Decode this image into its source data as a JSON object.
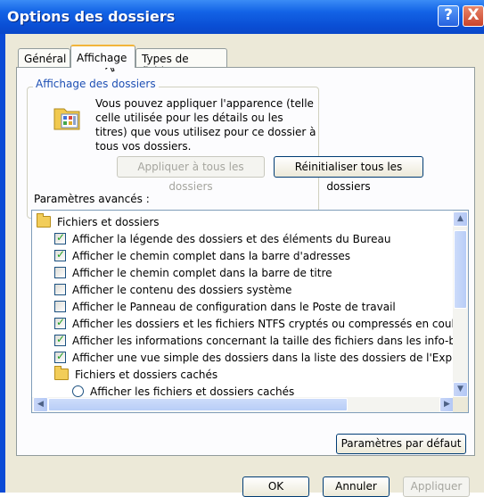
{
  "window": {
    "title": "Options des dossiers",
    "help_label": "?",
    "close_label": "X"
  },
  "tabs": [
    {
      "label": "Général"
    },
    {
      "label": "Affichage",
      "active": true
    },
    {
      "label": "Types de fichiers"
    }
  ],
  "folder_view": {
    "group_title": "Affichage des dossiers",
    "description": "Vous pouvez appliquer l'apparence (telle celle utilisée pour les détails ou les titres) que vous utilisez pour ce dossier à tous vos dossiers.",
    "apply_all_label": "Appliquer à tous les dossiers",
    "reset_all_label": "Réinitialiser tous les dossiers"
  },
  "advanced": {
    "label": "Paramètres avancés :",
    "items": [
      {
        "type": "folder",
        "text": "Fichiers et dossiers"
      },
      {
        "type": "checkbox",
        "checked": true,
        "text": "Afficher la légende des dossiers et des éléments du Bureau"
      },
      {
        "type": "checkbox",
        "checked": true,
        "text": "Afficher le chemin complet dans la barre d'adresses"
      },
      {
        "type": "checkbox",
        "checked": false,
        "text": "Afficher le chemin complet dans la barre de titre"
      },
      {
        "type": "checkbox",
        "checked": false,
        "text": "Afficher le contenu des dossiers système"
      },
      {
        "type": "checkbox",
        "checked": false,
        "text": "Afficher le Panneau de configuration dans le Poste de travail"
      },
      {
        "type": "checkbox",
        "checked": true,
        "text": "Afficher les dossiers et les fichiers NTFS cryptés ou compressés en coule"
      },
      {
        "type": "checkbox",
        "checked": true,
        "text": "Afficher les informations concernant la taille des fichiers dans les info-bulle"
      },
      {
        "type": "checkbox",
        "checked": true,
        "text": "Afficher une vue simple des dossiers dans la liste des dossiers de l'Explora"
      },
      {
        "type": "folder",
        "text": "Fichiers et dossiers cachés"
      },
      {
        "type": "radio",
        "checked": false,
        "text": "Afficher les fichiers et dossiers cachés"
      }
    ],
    "restore_defaults_label": "Paramètres par défaut"
  },
  "footer": {
    "ok_label": "OK",
    "cancel_label": "Annuler",
    "apply_label": "Appliquer"
  }
}
